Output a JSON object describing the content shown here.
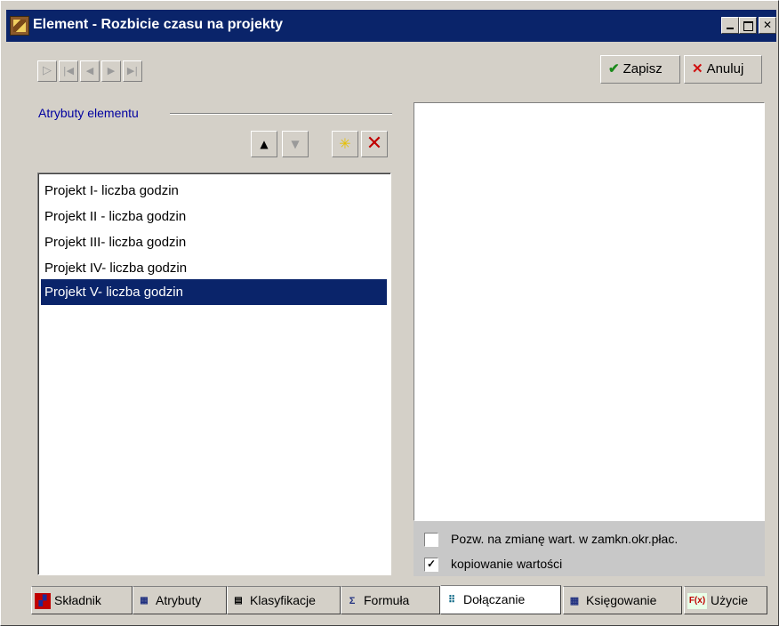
{
  "window": {
    "title": "Element - Rozbicie czasu na projekty"
  },
  "toolbar": {
    "nav_buttons": [
      {
        "icon": "first-record-icon",
        "glyph": "▷"
      },
      {
        "icon": "first-icon",
        "glyph": "|◀"
      },
      {
        "icon": "prev-icon",
        "glyph": "◀"
      },
      {
        "icon": "next-icon",
        "glyph": "▶"
      },
      {
        "icon": "last-icon",
        "glyph": "▶|"
      }
    ],
    "save_label": "Zapisz",
    "cancel_label": "Anuluj"
  },
  "attributes": {
    "group_label": "Atrybuty elementu",
    "items": [
      "Projekt I- liczba godzin",
      "Projekt II - liczba godzin",
      "Projekt III- liczba godzin",
      "Projekt IV- liczba godzin",
      "Projekt V- liczba godzin"
    ],
    "selected_index": 4
  },
  "options": {
    "allow_change_label": "Pozw. na zmianę wart. w zamkn.okr.płac.",
    "allow_change_checked": false,
    "copy_values_label": "kopiowanie wartości",
    "copy_values_checked": true
  },
  "tabs": [
    {
      "label": "Składnik",
      "icon": "component-icon"
    },
    {
      "label": "Atrybuty",
      "icon": "attributes-icon"
    },
    {
      "label": "Klasyfikacje",
      "icon": "classification-icon"
    },
    {
      "label": "Formuła",
      "icon": "formula-icon"
    },
    {
      "label": "Dołączanie",
      "icon": "attach-icon",
      "active": true
    },
    {
      "label": "Księgowanie",
      "icon": "accounting-icon"
    },
    {
      "label": "Użycie",
      "icon": "usage-icon"
    }
  ],
  "colors": {
    "title_bar": "#0a246a",
    "selection": "#0a246a",
    "group_label": "#0000a0",
    "save_icon": "#1a8a1a",
    "cancel_icon": "#d01010"
  }
}
